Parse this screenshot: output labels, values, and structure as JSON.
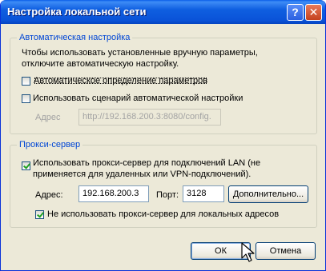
{
  "window": {
    "title": "Настройка локальной сети"
  },
  "titlebar_buttons": {
    "help": "?",
    "close": "✕"
  },
  "auto_config": {
    "legend": "Автоматическая настройка",
    "description_line1": "Чтобы использовать установленные вручную параметры,",
    "description_line2": "отключите автоматическую настройку.",
    "auto_detect_label": "Автоматическое определение параметров",
    "auto_detect_checked": false,
    "script_label": "Использовать сценарий автоматической настройки",
    "script_checked": false,
    "address_label": "Адрес",
    "address_value": "http://192.168.200.3:8080/config."
  },
  "proxy": {
    "legend": "Прокси-сервер",
    "use_proxy_line1": "Использовать прокси-сервер для подключений LAN (не",
    "use_proxy_line2": "применяется для удаленных или VPN-подключений).",
    "use_proxy_checked": true,
    "address_label": "Адрес:",
    "address_value": "192.168.200.3",
    "port_label": "Порт:",
    "port_value": "3128",
    "advanced_button": "Дополнительно...",
    "bypass_local_label": "Не использовать прокси-сервер для локальных адресов",
    "bypass_local_checked": true
  },
  "buttons": {
    "ok": "ОК",
    "cancel": "Отмена"
  },
  "colors": {
    "legend": "#0046d5",
    "titlebar": "#0a52d8",
    "dialog_bg": "#ece9d8"
  }
}
